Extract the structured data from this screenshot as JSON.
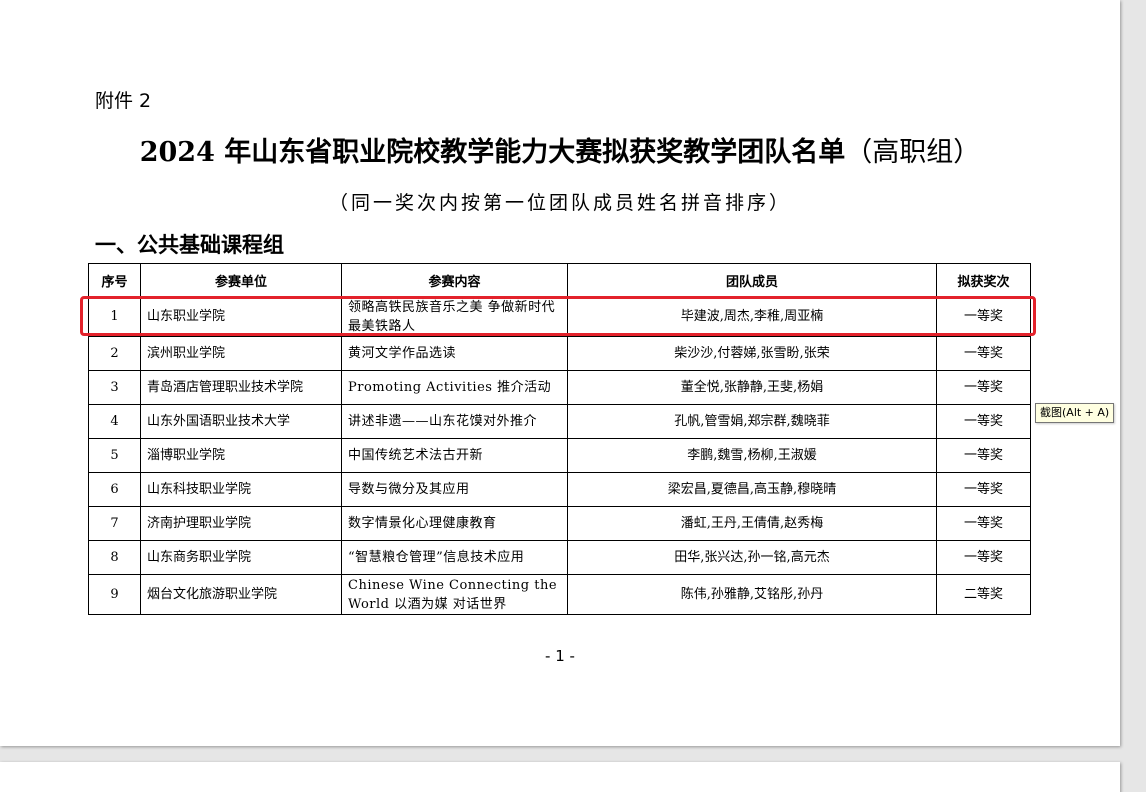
{
  "document": {
    "attachment_label": "附件 2",
    "title_main": "2024 年山东省职业院校教学能力大赛拟获奖教学团队名单",
    "title_suffix": "（高职组）",
    "subtitle": "（同一奖次内按第一位团队成员姓名拼音排序）",
    "section_title": "一、公共基础课程组",
    "page_number": "- 1 -"
  },
  "table": {
    "headers": {
      "no": "序号",
      "unit": "参赛单位",
      "content": "参赛内容",
      "members": "团队成员",
      "award": "拟获奖次"
    },
    "rows": [
      {
        "no": "1",
        "unit": "山东职业学院",
        "content": "领略高铁民族音乐之美 争做新时代最美铁路人",
        "members": "毕建波,周杰,李稚,周亚楠",
        "award": "一等奖"
      },
      {
        "no": "2",
        "unit": "滨州职业学院",
        "content": "黄河文学作品选读",
        "members": "柴沙沙,付蓉娣,张雪盼,张荣",
        "award": "一等奖"
      },
      {
        "no": "3",
        "unit": "青岛酒店管理职业技术学院",
        "content": "Promoting Activities 推介活动",
        "members": "董全悦,张静静,王斐,杨娟",
        "award": "一等奖"
      },
      {
        "no": "4",
        "unit": "山东外国语职业技术大学",
        "content": "讲述非遗——山东花馍对外推介",
        "members": "孔帆,管雪娟,郑宗群,魏晓菲",
        "award": "一等奖"
      },
      {
        "no": "5",
        "unit": "淄博职业学院",
        "content": "中国传统艺术法古开新",
        "members": "李鹏,魏雪,杨柳,王淑媛",
        "award": "一等奖"
      },
      {
        "no": "6",
        "unit": "山东科技职业学院",
        "content": "导数与微分及其应用",
        "members": "梁宏昌,夏德昌,高玉静,穆晓晴",
        "award": "一等奖"
      },
      {
        "no": "7",
        "unit": "济南护理职业学院",
        "content": "数字情景化心理健康教育",
        "members": "潘虹,王丹,王倩倩,赵秀梅",
        "award": "一等奖"
      },
      {
        "no": "8",
        "unit": "山东商务职业学院",
        "content": "“智慧粮仓管理”信息技术应用",
        "members": "田华,张兴达,孙一铭,高元杰",
        "award": "一等奖"
      },
      {
        "no": "9",
        "unit": "烟台文化旅游职业学院",
        "content": "Chinese Wine Connecting the World 以酒为媒 对话世界",
        "members": "陈伟,孙雅静,艾铭彤,孙丹",
        "award": "二等奖"
      }
    ]
  },
  "tooltip": {
    "text": "截图(Alt + A)"
  },
  "colors": {
    "highlight": "#e3222b",
    "tooltip_bg": "#ffffe1"
  }
}
